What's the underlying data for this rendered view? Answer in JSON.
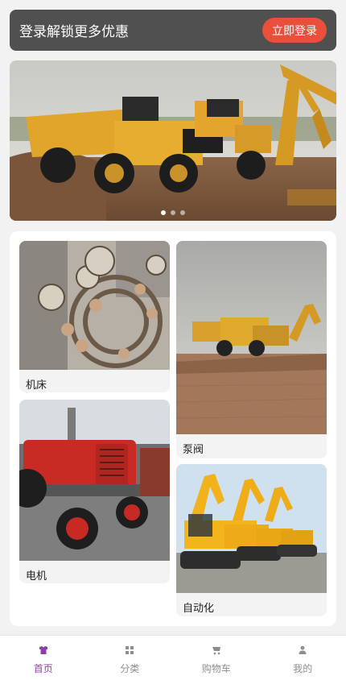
{
  "login_banner": {
    "text": "登录解锁更多优惠",
    "button_label": "立即登录"
  },
  "carousel": {
    "slides": 3,
    "active_index": 0
  },
  "categories": [
    {
      "label": "机床"
    },
    {
      "label": "泵阀"
    },
    {
      "label": "电机"
    },
    {
      "label": "自动化"
    }
  ],
  "tabbar": {
    "active": "home",
    "tabs": [
      {
        "id": "home",
        "label": "首页",
        "icon": "shirt-icon"
      },
      {
        "id": "category",
        "label": "分类",
        "icon": "grid-icon"
      },
      {
        "id": "cart",
        "label": "购物车",
        "icon": "cart-icon"
      },
      {
        "id": "mine",
        "label": "我的",
        "icon": "user-icon"
      }
    ]
  },
  "colors": {
    "accent": "#8b3fa8",
    "login_button": "#e8503b",
    "banner_bg": "#505050"
  }
}
